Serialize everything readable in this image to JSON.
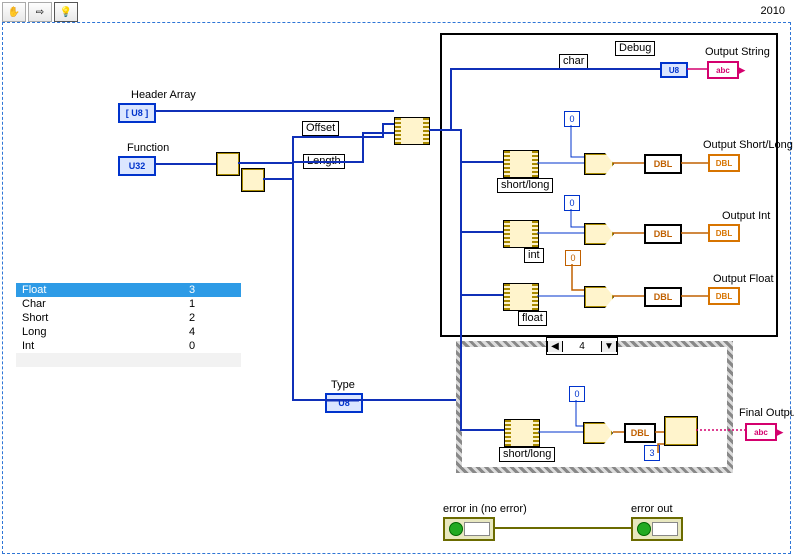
{
  "toolbar": {
    "hand": "✋",
    "arrow": "⇨",
    "highlight": "💡"
  },
  "version": "2010",
  "controls": {
    "header_array": {
      "label": "Header Array",
      "type": "[ U8 ]"
    },
    "function": {
      "label": "Function",
      "type": "U32"
    },
    "type": {
      "label": "Type",
      "type": "U8"
    }
  },
  "labels": {
    "offset": "Offset",
    "length": "Length",
    "char": "char",
    "debug": "Debug",
    "shortlong": "short/long",
    "int_lbl": "int",
    "float_lbl": "float",
    "shortlong2": "short/long"
  },
  "outputs": {
    "out_string": "Output String",
    "out_short": "Output Short/Long",
    "out_int": "Output Int",
    "out_float": "Output Float",
    "final_out": "Final Output"
  },
  "dbl_text": "DBL",
  "case": {
    "left": "◀",
    "value": "4",
    "right": "▼"
  },
  "consts": {
    "zero": "0",
    "three": "3"
  },
  "table": {
    "rows": [
      {
        "name": "Float",
        "val": "3",
        "sel": true
      },
      {
        "name": "Char",
        "val": "1"
      },
      {
        "name": "Short",
        "val": "2"
      },
      {
        "name": "Long",
        "val": "4"
      },
      {
        "name": "Int",
        "val": "0"
      }
    ]
  },
  "errors": {
    "in": "error in (no error)",
    "out": "error out"
  }
}
